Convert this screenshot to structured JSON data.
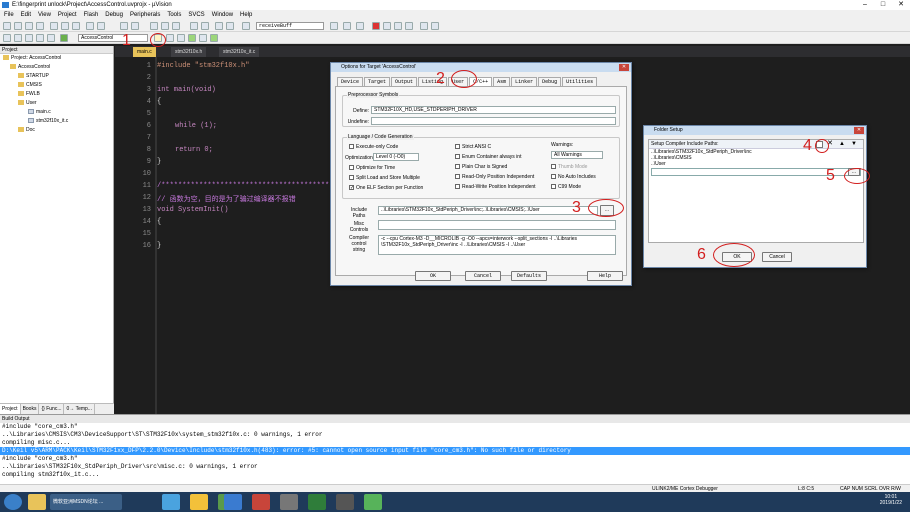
{
  "window": {
    "title": "E:\\fingerprint unlock\\Project\\AccessControl.uvprojx - µVision"
  },
  "menu": [
    "File",
    "Edit",
    "View",
    "Project",
    "Flash",
    "Debug",
    "Peripherals",
    "Tools",
    "SVCS",
    "Window",
    "Help"
  ],
  "toolbar": {
    "find_value": "receiveBuff",
    "target": "AccessControl"
  },
  "project": {
    "title": "Project",
    "tree": [
      {
        "label": "Project: AccessControl",
        "level": 0,
        "type": "root"
      },
      {
        "label": "AccessControl",
        "level": 1,
        "type": "folder"
      },
      {
        "label": "STARTUP",
        "level": 2,
        "type": "folder"
      },
      {
        "label": "CMSIS",
        "level": 2,
        "type": "folder"
      },
      {
        "label": "FWLB",
        "level": 2,
        "type": "folder"
      },
      {
        "label": "User",
        "level": 2,
        "type": "folder"
      },
      {
        "label": "main.c",
        "level": 3,
        "type": "file"
      },
      {
        "label": "stm32f10x_it.c",
        "level": 3,
        "type": "file"
      },
      {
        "label": "Doc",
        "level": 2,
        "type": "folder"
      }
    ],
    "tabs": [
      "Project",
      "Books",
      "{} Func...",
      "0→ Temp..."
    ]
  },
  "editor": {
    "tabs": [
      "main.c",
      "stm32f10x.h",
      "stm32f10x_it.c"
    ],
    "line_numbers": [
      "1",
      "2",
      "3",
      "4",
      "5",
      "6",
      "7",
      "8",
      "9",
      "10",
      "11",
      "12",
      "13",
      "14",
      "15",
      "16"
    ],
    "code": {
      "l1": "#include \"stm32f10x.h\"",
      "l3": "int main(void)",
      "l4": "{",
      "l6": "while (1);",
      "l8": "return 0;",
      "l9": "}",
      "l11": "/*****************************************",
      "l12": "// 函数为空，目的是为了骗过编译器不报错",
      "l13": "void SystemInit()",
      "l14": "{",
      "l16": "}"
    }
  },
  "options_dialog": {
    "title": "Options for Target 'AccessControl'",
    "tabs": [
      "Device",
      "Target",
      "Output",
      "Listing",
      "User",
      "C/C++",
      "Asm",
      "Linker",
      "Debug",
      "Utilities"
    ],
    "active_tab": "C/C++",
    "preprocessor": {
      "group": "Preprocessor Symbols",
      "define_label": "Define:",
      "define_value": "STM32F10X_HD,USE_STDPERIPH_DRIVER",
      "undefine_label": "Undefine:",
      "undefine_value": ""
    },
    "lang": {
      "group": "Language / Code Generation",
      "execute_only": "Execute-only Code",
      "optimization_label": "Optimization:",
      "optimization_value": "Level 0 (-O0)",
      "optimize_time": "Optimize for Time",
      "split_load": "Split Load and Store Multiple",
      "one_elf": "One ELF Section per Function",
      "strict_ansi": "Strict ANSI C",
      "enum_int": "Enum Container always int",
      "plain_char": "Plain Char is Signed",
      "ro_pi": "Read-Only Position Independent",
      "rw_pi": "Read-Write Position Independent",
      "warnings_label": "Warnings:",
      "warnings_value": "All Warnings",
      "thumb_mode": "Thumb Mode",
      "no_auto_includes": "No Auto Includes",
      "c99_mode": "C99 Mode"
    },
    "include_label": "Include\nPaths",
    "include_value": "..\\Libraries\\STM32F10x_StdPeriph_Driver\\inc;..\\Libraries\\CMSIS;..\\User",
    "misc_label": "Misc\nControls",
    "misc_value": "",
    "compiler_label": "Compiler\ncontrol\nstring",
    "compiler_line1": "-c --cpu Cortex-M3 -D__MICROLIB -g -O0 --apcs=interwork --split_sections -I ..\\Libraries",
    "compiler_line2": "\\STM32F10x_StdPeriph_Driver\\inc -I ..\\Libraries\\CMSIS -I ..\\User",
    "browse": "...",
    "buttons": {
      "ok": "OK",
      "cancel": "Cancel",
      "defaults": "Defaults",
      "help": "Help"
    }
  },
  "folder_dialog": {
    "title": "Folder Setup",
    "label": "Setup Compiler Include Paths:",
    "paths": [
      "..\\Libraries\\STM32F10x_StdPeriph_Driver\\inc",
      "..\\Libraries\\CMSIS",
      "..\\User",
      ""
    ],
    "browse": "...",
    "ok": "OK",
    "cancel": "Cancel"
  },
  "annotations": [
    "1",
    "2",
    "3",
    "4",
    "5",
    "6"
  ],
  "build": {
    "title": "Build Output",
    "lines": [
      "  #include \"core_cm3.h\"",
      "..\\Libraries\\CMSIS\\CM3\\DeviceSupport\\ST\\STM32F10x\\system_stm32f10x.c: 0 warnings, 1 error",
      "compiling misc.c...",
      "D:\\Keil v5\\ARM\\PACK\\Keil\\STM32F1xx_DFP\\2.2.0\\Device\\Include\\stm32f10x.h(483): error:  #5: cannot open source input file \"core_cm3.h\": No such file or directory",
      "  #include \"core_cm3.h\"",
      "..\\Libraries\\STM32F10x_StdPeriph_Driver\\src\\misc.c: 0 warnings, 1 error",
      "compiling stm32f10x_it.c..."
    ],
    "error_index": 3
  },
  "status": {
    "debugger": "ULINK2/ME Cortex Debugger",
    "position": "L:8 C:5",
    "flags": "CAP  NUM  SCRL  OVR  R/W"
  },
  "taskbar": {
    "active_item": "微软亚洲MSDN论坛 ...",
    "time": "10:01",
    "date": "2019/1/22"
  }
}
